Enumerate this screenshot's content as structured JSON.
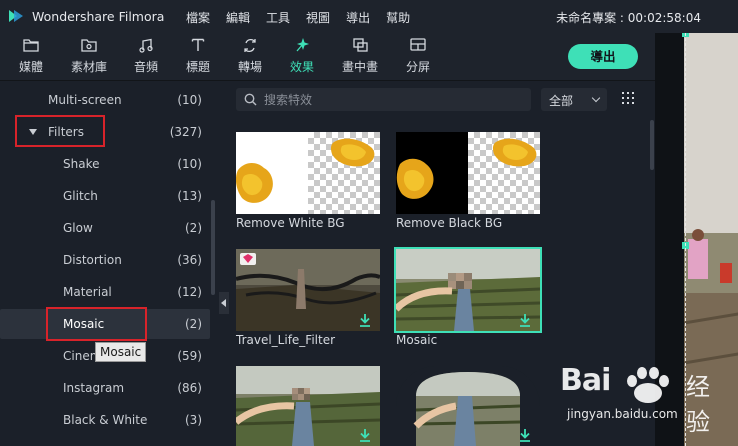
{
  "titlebar": {
    "app_name": "Wondershare Filmora",
    "menu": [
      "檔案",
      "編輯",
      "工具",
      "視圖",
      "導出",
      "幫助"
    ],
    "project": "未命名專案 : 00:02:58:04"
  },
  "toolbar": {
    "tabs": [
      {
        "label": "媒體",
        "icon": "folder-icon"
      },
      {
        "label": "素材庫",
        "icon": "image-folder-icon"
      },
      {
        "label": "音頻",
        "icon": "music-note-icon"
      },
      {
        "label": "標題",
        "icon": "text-icon"
      },
      {
        "label": "轉場",
        "icon": "transition-icon"
      },
      {
        "label": "效果",
        "icon": "effects-icon",
        "active": true
      },
      {
        "label": "畫中畫",
        "icon": "pip-icon"
      },
      {
        "label": "分屏",
        "icon": "split-screen-icon"
      }
    ],
    "export_label": "導出"
  },
  "sidebar": {
    "categories": [
      {
        "name": "Multi-screen",
        "count": "(10)"
      },
      {
        "name": "Filters",
        "count": "(327)",
        "expanded": true
      },
      {
        "name": "Shake",
        "count": "(10)"
      },
      {
        "name": "Glitch",
        "count": "(13)"
      },
      {
        "name": "Glow",
        "count": "(2)"
      },
      {
        "name": "Distortion",
        "count": "(36)"
      },
      {
        "name": "Material",
        "count": "(12)"
      },
      {
        "name": "Mosaic",
        "count": "(2)",
        "selected": true
      },
      {
        "name": "Cinema",
        "count": "(59)"
      },
      {
        "name": "Instagram",
        "count": "(86)"
      },
      {
        "name": "Black & White",
        "count": "(3)"
      }
    ],
    "tooltip": "Mosaic"
  },
  "search": {
    "placeholder": "搜索特效",
    "value": ""
  },
  "filter_dropdown": {
    "selected": "全部"
  },
  "effects": [
    {
      "label": "Remove White BG"
    },
    {
      "label": "Remove Black BG"
    },
    {
      "label": "Travel_Life_Filter"
    },
    {
      "label": "Mosaic",
      "selected": true
    },
    {
      "label": ""
    },
    {
      "label": ""
    }
  ],
  "watermark": {
    "brand": "Bai",
    "brand_cn": "经验",
    "url": "jingyan.baidu.com"
  },
  "colors": {
    "accent": "#3ee0b7",
    "highlight": "#d8232a",
    "background": "#1b2029"
  }
}
